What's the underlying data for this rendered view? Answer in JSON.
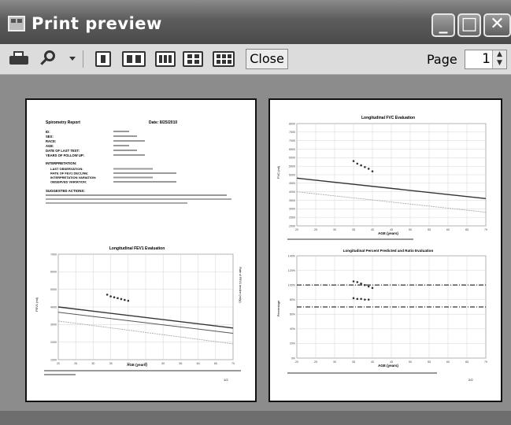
{
  "window": {
    "title": "Print preview",
    "minimize_glyph": "_",
    "maximize_glyph": "□",
    "close_glyph": "✕"
  },
  "toolbar": {
    "print_icon": "printer-icon",
    "zoom_icon": "magnifier-icon",
    "layouts": [
      "one-page",
      "two-pages",
      "three-pages",
      "four-pages",
      "six-pages"
    ],
    "close_label": "Close",
    "page_label": "Page",
    "page_value": "1"
  },
  "pages": {
    "left": {
      "report_title": "Spirometry Report",
      "date_label": "Date: 8/25/2010",
      "fields": [
        "ID:",
        "SEX:",
        "RACE:",
        "AGE:",
        "DATE OF LAST TEST:",
        "YEARS OF FOLLOW UP:"
      ],
      "interpretation_label": "INTERPRETATION:",
      "interp_items": [
        "LAST OBSERVATION:",
        "RATE OF FEV1 DECLINE:",
        "INTERPRETATION VARIATION:",
        "OBSERVED VARIATION:"
      ],
      "suggested_label": "SUGGESTED ACTIONS:",
      "chart_title": "Longitudinal FEV1 Evaluation",
      "ylabel": "FEV1 (ml)",
      "xlabel": "AGE (years)",
      "y2label": "Rate of FEV1 decline (ml/yr)",
      "page_number": "1/2"
    },
    "right": {
      "chart1_title": "Longitudinal FVC Evaluation",
      "chart1_ylabel": "FVC (ml)",
      "chart1_xlabel": "AGE (years)",
      "chart2_title": "Longitudinal Percent Predicted and Ratio Evaluation",
      "chart2_ylabel": "Percentage",
      "chart2_xlabel": "AGE (years)",
      "page_number": "2/2"
    }
  },
  "chart_data": [
    {
      "type": "line",
      "title": "Longitudinal FEV1 Evaluation",
      "xlabel": "AGE (years)",
      "ylabel": "FEV1 (ml)",
      "xlim": [
        20,
        70
      ],
      "ylim": [
        1000,
        7000
      ],
      "x_ticks": [
        "20",
        "25",
        "30",
        "35",
        "40",
        "45",
        "50",
        "55",
        "60",
        "65",
        "70"
      ],
      "y_ticks": [
        "1000",
        "2000",
        "3000",
        "4000",
        "5000",
        "6000",
        "7000"
      ],
      "series": [
        {
          "values_x": [
            20,
            70
          ],
          "values_y": [
            4000,
            2800
          ]
        },
        {
          "values_x": [
            20,
            70
          ],
          "values_y": [
            3700,
            2500
          ]
        },
        {
          "values_x": [
            20,
            70
          ],
          "values_y": [
            3200,
            1900
          ]
        },
        {
          "values_x": [
            34,
            35,
            36,
            37,
            38,
            39,
            40
          ],
          "values_y": [
            4700,
            4600,
            4550,
            4500,
            4450,
            4400,
            4350
          ]
        }
      ]
    },
    {
      "type": "line",
      "title": "Longitudinal FVC Evaluation",
      "xlabel": "AGE (years)",
      "ylabel": "FVC (ml)",
      "xlim": [
        20,
        70
      ],
      "ylim": [
        2000,
        8000
      ],
      "x_ticks": [
        "20",
        "25",
        "30",
        "35",
        "40",
        "45",
        "50",
        "55",
        "60",
        "65",
        "70"
      ],
      "y_ticks": [
        "2000",
        "2500",
        "3000",
        "3500",
        "4000",
        "4500",
        "5000",
        "5500",
        "6000",
        "6500",
        "7000",
        "7500",
        "8000"
      ],
      "series": [
        {
          "values_x": [
            20,
            70
          ],
          "values_y": [
            4800,
            3600
          ]
        },
        {
          "values_x": [
            20,
            70
          ],
          "values_y": [
            4000,
            2800
          ]
        },
        {
          "values_x": [
            35,
            36,
            37,
            38,
            39,
            40
          ],
          "values_y": [
            5800,
            5650,
            5550,
            5450,
            5350,
            5200
          ]
        }
      ]
    },
    {
      "type": "line",
      "title": "Longitudinal Percent Predicted and Ratio Evaluation",
      "xlabel": "AGE (years)",
      "ylabel": "Percentage",
      "xlim": [
        20,
        70
      ],
      "ylim": [
        0,
        140
      ],
      "x_ticks": [
        "20",
        "25",
        "30",
        "35",
        "40",
        "45",
        "50",
        "55",
        "60",
        "65",
        "70"
      ],
      "y_ticks": [
        "0%",
        "20%",
        "40%",
        "60%",
        "80%",
        "100%",
        "120%",
        "140%"
      ],
      "series": [
        {
          "values_x": [
            20,
            70
          ],
          "values_y": [
            100,
            100
          ]
        },
        {
          "values_x": [
            20,
            70
          ],
          "values_y": [
            70,
            70
          ]
        },
        {
          "values_x": [
            35,
            36,
            37,
            38,
            39,
            40
          ],
          "values_y": [
            105,
            104,
            102,
            100,
            98,
            96
          ]
        },
        {
          "values_x": [
            35,
            36,
            37,
            38,
            39
          ],
          "values_y": [
            82,
            81,
            81,
            80,
            80
          ]
        }
      ]
    }
  ]
}
